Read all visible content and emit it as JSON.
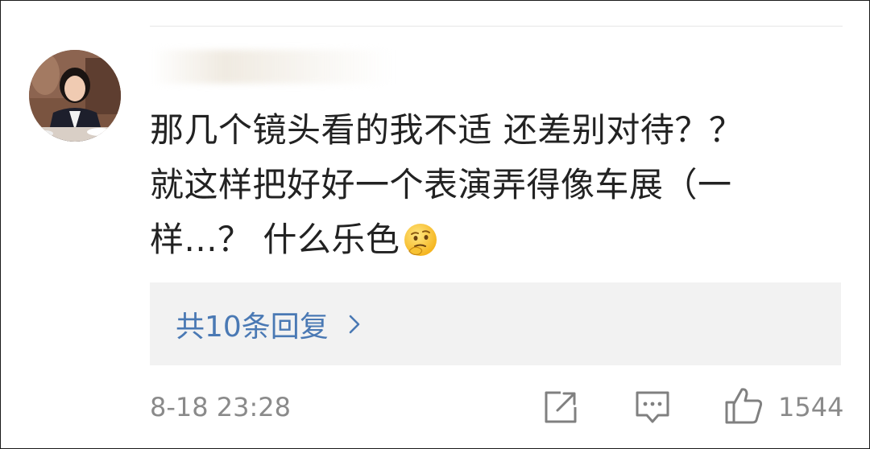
{
  "comment": {
    "user": {
      "name": ""
    },
    "text_lines": [
      "那几个镜头看的我不适 还差别对待？？",
      "就这样把好好一个表演弄得像车展（一",
      "样...？ 什么乐色"
    ],
    "emoji": "thinking-face-emoji",
    "replies_label": "共10条回复",
    "timestamp": "8-18 23:28",
    "like_count": "1544"
  },
  "colors": {
    "reply_link": "#4a79b4",
    "meta_text": "#8a8a8a",
    "reply_bg": "#f2f2f2",
    "body_text": "#222222"
  },
  "icons": [
    "share-icon",
    "comment-icon",
    "thumbs-up-icon",
    "chevron-right-icon"
  ]
}
